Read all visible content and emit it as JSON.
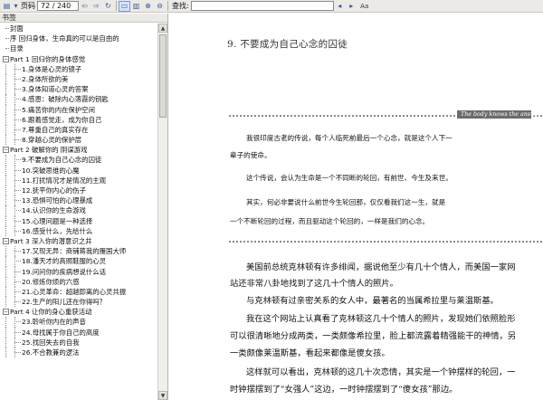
{
  "toolbar": {
    "page_label": "页码",
    "page_value": "72 / 240",
    "find_label": "查找:",
    "search_value": "",
    "case_label": "Aa"
  },
  "sidebar": {
    "title": "书签",
    "items": [
      {
        "label": "封面",
        "level": 0,
        "toggle": ""
      },
      {
        "label": "序 回归身体，生命真的可以是自由的",
        "level": 0,
        "toggle": ""
      },
      {
        "label": "目录",
        "level": 0,
        "toggle": ""
      },
      {
        "label": "Part 1 回归你的身体感觉",
        "level": 0,
        "toggle": "−"
      },
      {
        "label": "1.身体是心灵的镜子",
        "level": 1,
        "toggle": ""
      },
      {
        "label": "2.身体所欲的美",
        "level": 1,
        "toggle": ""
      },
      {
        "label": "3.身体知道心灵的答案",
        "level": 1,
        "toggle": ""
      },
      {
        "label": "4.感恩：破除内心落霞的钥匙",
        "level": 1,
        "toggle": ""
      },
      {
        "label": "5.痛苦你的内在保护空间",
        "level": 1,
        "toggle": ""
      },
      {
        "label": "6.跟着感觉走，成为你自己",
        "level": 1,
        "toggle": ""
      },
      {
        "label": "7.尊重自己的真实存在",
        "level": 1,
        "toggle": ""
      },
      {
        "label": "8.穿越心灵的保护层",
        "level": 1,
        "toggle": ""
      },
      {
        "label": "Part 2 破解你的 阴谋游戏",
        "level": 0,
        "toggle": "−"
      },
      {
        "label": "9.不要成为自己心念的囚徒",
        "level": 1,
        "toggle": ""
      },
      {
        "label": "10.突破思维的心魔",
        "level": 1,
        "toggle": ""
      },
      {
        "label": "11.打扰情况才是情况的主观",
        "level": 1,
        "toggle": ""
      },
      {
        "label": "12.抚平你内心的伤子",
        "level": 1,
        "toggle": ""
      },
      {
        "label": "13.恐惧可怕的心理暴成",
        "level": 1,
        "toggle": ""
      },
      {
        "label": "14.认识你的生命游戏",
        "level": 1,
        "toggle": ""
      },
      {
        "label": "15.心理问题是一种选择",
        "level": 1,
        "toggle": ""
      },
      {
        "label": "16.感受什么，先给什么",
        "level": 1,
        "toggle": ""
      },
      {
        "label": "Part 3 深入你的潜意识之井",
        "level": 0,
        "toggle": "−"
      },
      {
        "label": "17.又现无异：商铺蒋我的雁国大师",
        "level": 1,
        "toggle": ""
      },
      {
        "label": "18.潘天才的高照鞋服的心灵",
        "level": 1,
        "toggle": ""
      },
      {
        "label": "19.问问你的疾病想说什么话",
        "level": 1,
        "toggle": ""
      },
      {
        "label": "20.修炼你烦的六感",
        "level": 1,
        "toggle": ""
      },
      {
        "label": "21.心灵革命：超越即离的心灵共振",
        "level": 1,
        "toggle": ""
      },
      {
        "label": "22.生产的阳儿还在你得吗？",
        "level": 1,
        "toggle": ""
      },
      {
        "label": "Part 4 让你的身心重获活动",
        "level": 0,
        "toggle": "−"
      },
      {
        "label": "23.聆听你内在的声音",
        "level": 1,
        "toggle": ""
      },
      {
        "label": "24.母找属于你自己的高度",
        "level": 1,
        "toggle": ""
      },
      {
        "label": "25.找回失去的自我",
        "level": 1,
        "toggle": ""
      },
      {
        "label": "26.不合教兼的逻法",
        "level": 1,
        "toggle": ""
      }
    ]
  },
  "document": {
    "chapter_title": "9. 不要成为自己心念的囚徒",
    "tag": "The body knows the answer",
    "quote_lines": [
      "我很印度古老的传说，每个人临死前最后一个心念，就是这个人下一",
      "辈子的使命。",
      "这个传说，会认为生命是一个不同断的轮回，有前世、今生及来世。",
      "其实，何必非要说什么前世今生轮回那，仅仅看我们这一生，就是",
      "一个不断轮回的过程，而且驱动这个轮回的，一样是我们的心念。"
    ],
    "body_lines": [
      "美国前总统克林顿有许多绯闻，据说他至少有几十个情人，而美国一家网",
      "站还非常八卦地找到了这几十个情人的照片。",
      "与克林顿有过亲密关系的女人中，最著名的当属希拉里与莱温斯基。",
      "我在这个网站上认真看了克林顿这几十个情人的照片，发现她们依照脸形",
      "可以很清晰地分成两类，一类颇像希拉里，脸上都流露着精强能干的神情，另",
      "一类颇像莱温斯基，看起来都像是傻女孩。",
      "这样就可以看出，克林顿的这几十次恋情，其实是一个钟摆样的轮回，一",
      "时钟摆摆到了“女强人”这边，一时钟摆摆到了“傻女孩”那边。"
    ]
  }
}
